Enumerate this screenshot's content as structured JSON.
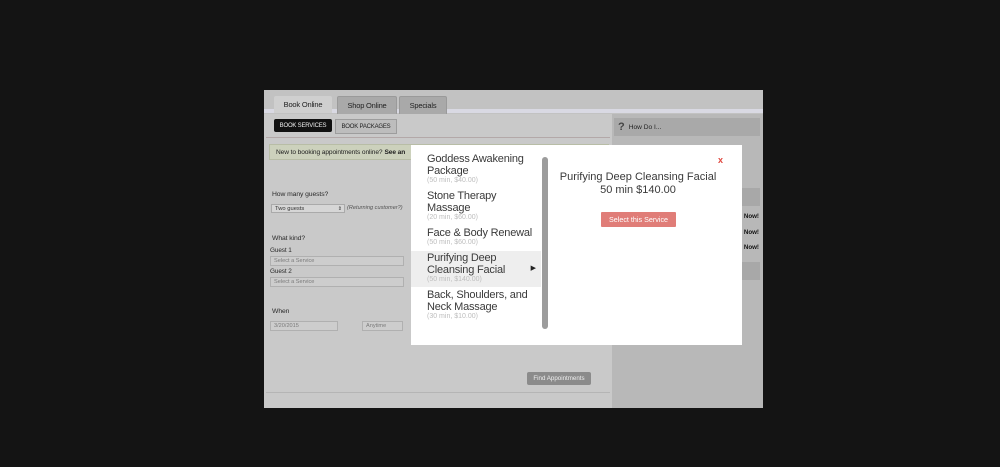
{
  "tabs": [
    {
      "label": "Book Online"
    },
    {
      "label": "Shop Online"
    },
    {
      "label": "Specials"
    }
  ],
  "booking": {
    "book_services": "BOOK SERVICES",
    "book_packages": "BOOK PACKAGES",
    "notice_text": "New to booking appointments online?",
    "notice_link": "See an",
    "guests_label": "How many guests?",
    "guests_value": "Two guests",
    "returning": "(Returning customer?)",
    "kind_label": "What kind?",
    "guest1_label": "Guest 1",
    "guest1_placeholder": "Select a Service",
    "guest2_label": "Guest 2",
    "guest2_placeholder": "Select a Service",
    "when_label": "When",
    "date_value": "3/20/2015",
    "time_value": "Anytime",
    "find_button": "Find Appointments"
  },
  "sidebar": {
    "how_do": "How Do I...",
    "now_labels": [
      "Now!",
      "Now!",
      "Now!"
    ]
  },
  "modal": {
    "close": "x",
    "services": [
      {
        "name": "Goddess Awakening Package",
        "meta": "(50 min, $40.00)"
      },
      {
        "name": "Stone Therapy Massage",
        "meta": "(20 min, $60.00)"
      },
      {
        "name": "Face & Body Renewal",
        "meta": "(50 min, $60.00)"
      },
      {
        "name": "Purifying Deep Cleansing Facial",
        "meta": "(50 min, $140.00)"
      },
      {
        "name": "Back, Shoulders, and Neck Massage",
        "meta": "(30 min, $10.00)"
      }
    ],
    "selected_name": "Purifying Deep Cleansing Facial",
    "selected_price": "50 min $140.00",
    "select_button": "Select this Service"
  }
}
